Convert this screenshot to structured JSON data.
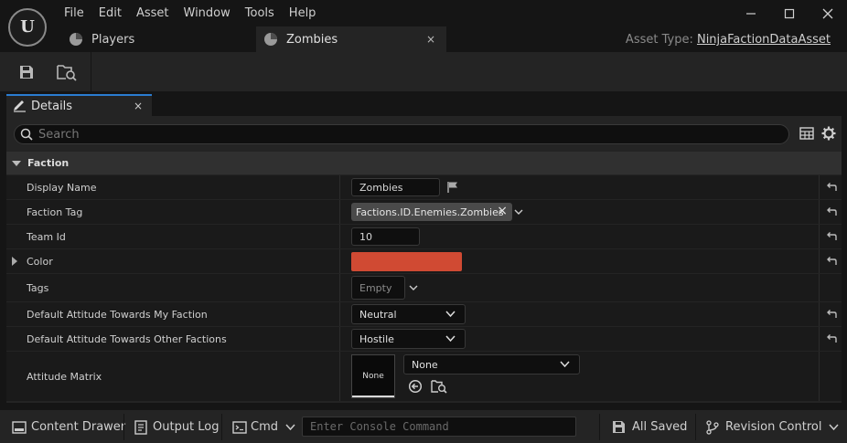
{
  "menu": [
    "File",
    "Edit",
    "Asset",
    "Window",
    "Tools",
    "Help"
  ],
  "window_controls": [
    "minimize-icon",
    "maximize-icon",
    "close-icon"
  ],
  "tabs": [
    {
      "label": "Players",
      "active": false
    },
    {
      "label": "Zombies",
      "active": true,
      "close": "×"
    }
  ],
  "asset_type": {
    "label": "Asset Type:",
    "value": "NinjaFactionDataAsset"
  },
  "toolbar": {
    "icons": [
      "save-icon",
      "browse-to-asset-icon"
    ]
  },
  "details_tab": {
    "label": "Details",
    "close": "×"
  },
  "search": {
    "placeholder": "Search"
  },
  "category": {
    "label": "Faction"
  },
  "properties": {
    "display_name": {
      "label": "Display Name",
      "value": "Zombies"
    },
    "faction_tag": {
      "label": "Faction Tag",
      "value": "Factions.ID.Enemies.Zombies",
      "remove": "×"
    },
    "team_id": {
      "label": "Team Id",
      "value": "10"
    },
    "color": {
      "label": "Color",
      "value": "#d04a33"
    },
    "tags": {
      "label": "Tags",
      "value": "Empty"
    },
    "attitude_my_faction": {
      "label": "Default Attitude Towards My Faction",
      "value": "Neutral"
    },
    "attitude_other_factions": {
      "label": "Default Attitude Towards Other Factions",
      "value": "Hostile"
    },
    "attitude_matrix": {
      "label": "Attitude Matrix",
      "thumbnail": "None",
      "value": "None"
    }
  },
  "statusbar": {
    "content_drawer": "Content Drawer",
    "output_log": "Output Log",
    "cmd": "Cmd",
    "console_placeholder": "Enter Console Command",
    "all_saved": "All Saved",
    "revision_control": "Revision Control"
  },
  "colors": {
    "accent": "#2a7cd0",
    "faction_color": "#d04a33",
    "panel_bg": "#242424",
    "row_bg": "#1a1a1a"
  }
}
